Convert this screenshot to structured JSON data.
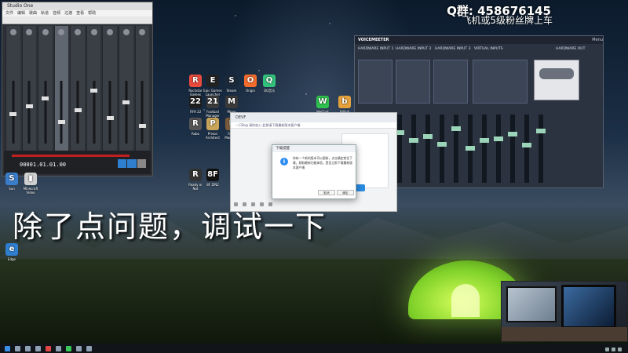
{
  "overlay": {
    "qq_group": "Q群: 458676145",
    "subtitle_top": "飞机或5级粉丝牌上车",
    "subtitle_main": "除了点问题，调试一下"
  },
  "daw": {
    "title": "Studio One",
    "menu": [
      "文件",
      "编辑",
      "歌曲",
      "轨道",
      "音频",
      "过渡",
      "查看",
      "帮助"
    ],
    "time": "00001.01.01.00"
  },
  "voicemeeter": {
    "title": "VOICEMEETER",
    "hw_inputs": [
      "HARDWARE INPUT 1",
      "HARDWARE INPUT 2",
      "HARDWARE INPUT 3"
    ],
    "virtual_inputs": "VIRTUAL INPUTS",
    "hw_out": "HARDWARE OUT",
    "menu": "Menu"
  },
  "desktop_icons": [
    {
      "label": "Rockstar Games",
      "color": "#e84b3c",
      "glyph": "R"
    },
    {
      "label": "Epic Games Launcher",
      "color": "#222222",
      "glyph": "E"
    },
    {
      "label": "Steam",
      "color": "#1b2838",
      "glyph": "S"
    },
    {
      "label": "Origin",
      "color": "#f56c2d",
      "glyph": "O"
    },
    {
      "label": "QQ音乐",
      "color": "#31c27c",
      "glyph": "Q"
    },
    {
      "label": "FIFA 22",
      "color": "#1e1e1e",
      "glyph": "22"
    },
    {
      "label": "Football Manager",
      "color": "#3b3b3b",
      "glyph": "21"
    },
    {
      "label": "Mixer",
      "color": "#3a3a3a",
      "glyph": "M"
    },
    {
      "label": "Robo",
      "color": "#555555",
      "glyph": "R"
    },
    {
      "label": "Prison Architect",
      "color": "#c9a55a",
      "glyph": "P"
    },
    {
      "label": "Farm Manager",
      "color": "#7a5a3a",
      "glyph": "F"
    },
    {
      "label": "Ready or Not",
      "color": "#333333",
      "glyph": "R"
    },
    {
      "label": "8F ZIN2",
      "color": "#111111",
      "glyph": "8F"
    },
    {
      "label": "Sun",
      "color": "#3a7ec9",
      "glyph": "S"
    },
    {
      "label": "Minecraft Video",
      "color": "#d0d0d0",
      "glyph": "▮"
    },
    {
      "label": "Edge",
      "color": "#2f7fd0",
      "glyph": "e"
    },
    {
      "label": "WeChat",
      "color": "#2ec24d",
      "glyph": "W"
    },
    {
      "label": "Bilibili",
      "color": "#e5a13b",
      "glyph": "b"
    }
  ],
  "chat": {
    "title": "DEVF",
    "notice": "一只Bug 请你加入 此群请下载最新版本客户端",
    "button": "去看看"
  },
  "dialog": {
    "title": "下载提醒",
    "message": "你有一个新的版本可以更新，点击确定前往下载，获取最新功能体验，是否立即下载最新版本客户端",
    "ok": "取消",
    "cancel": "确定"
  }
}
